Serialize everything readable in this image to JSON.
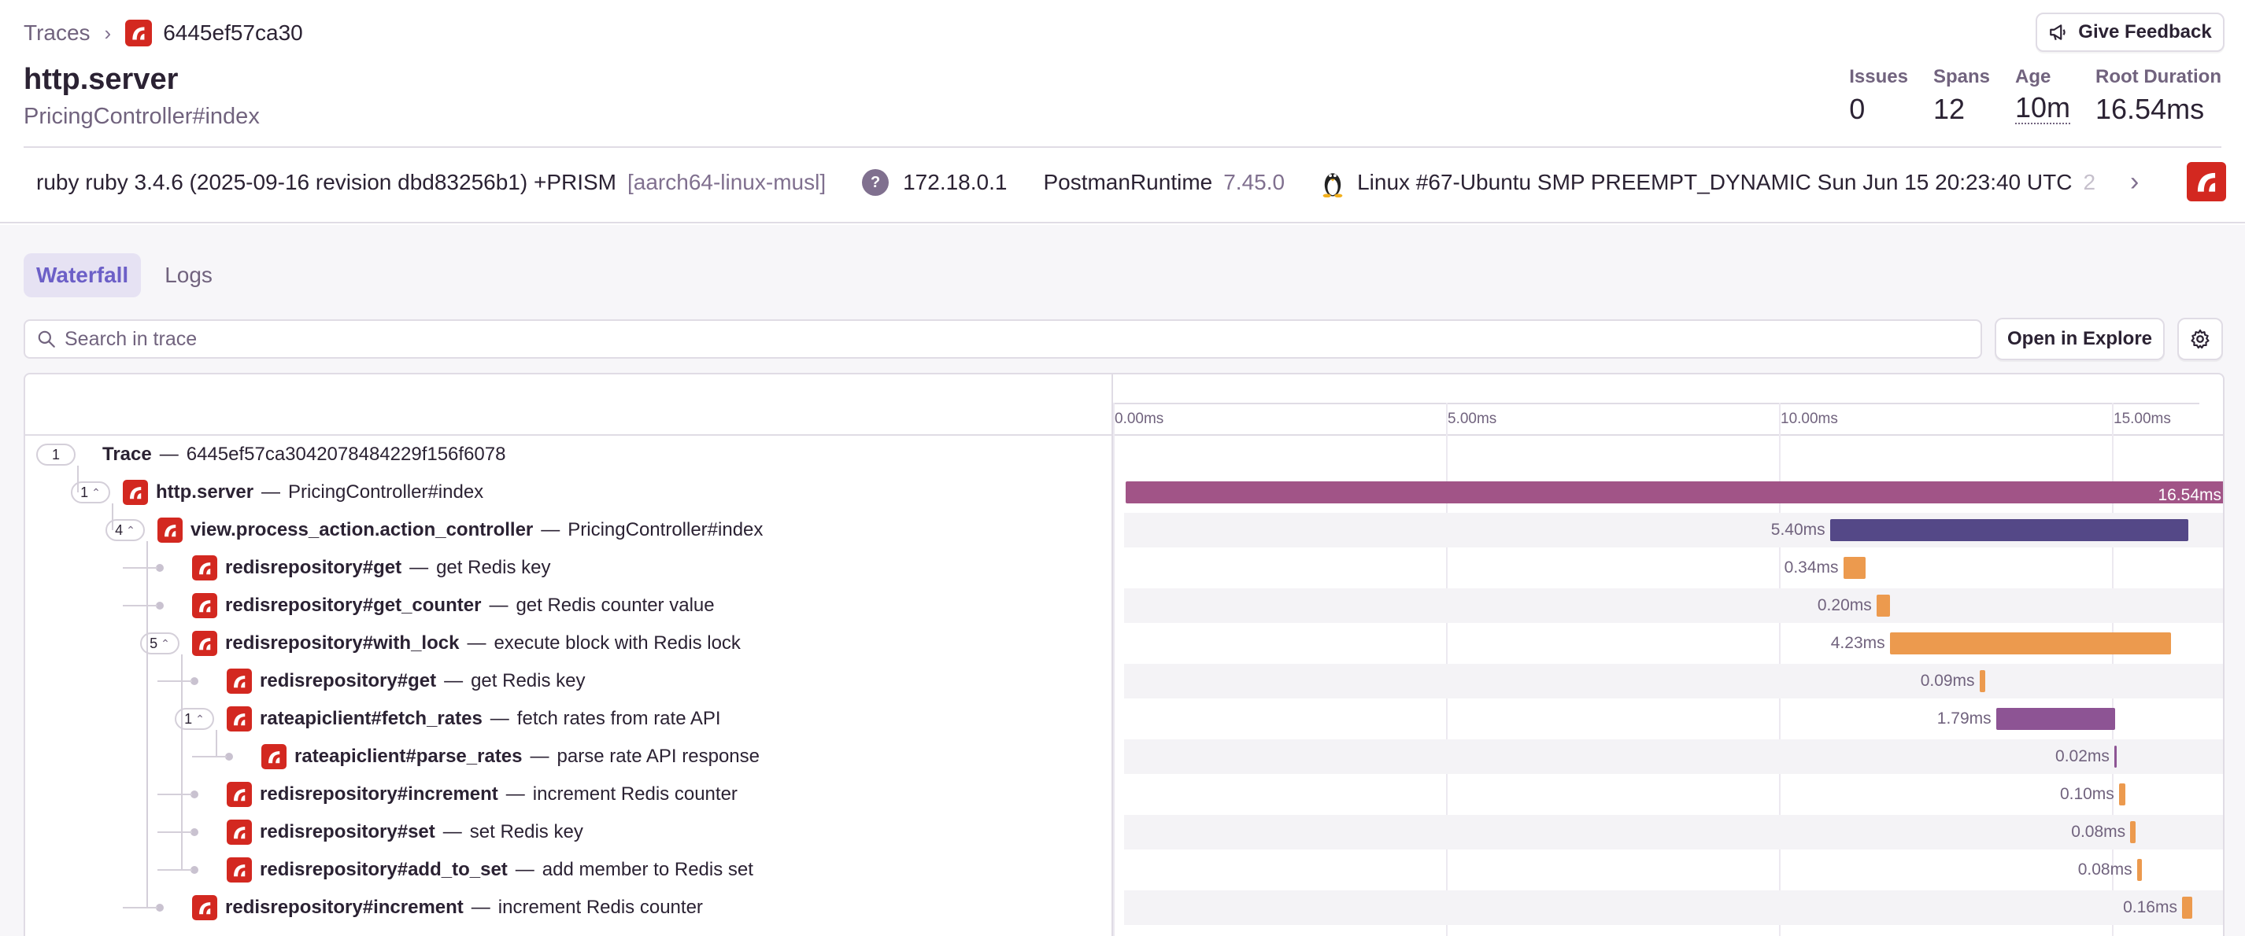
{
  "breadcrumb": {
    "root": "Traces",
    "separator": "›",
    "trace_id": "6445ef57ca30"
  },
  "feedback_button": "Give Feedback",
  "header": {
    "title": "http.server",
    "subtitle": "PricingController#index"
  },
  "stats": [
    {
      "label": "Issues",
      "value": "0"
    },
    {
      "label": "Spans",
      "value": "12"
    },
    {
      "label": "Age",
      "value": "10m"
    },
    {
      "label": "Root Duration",
      "value": "16.54ms"
    }
  ],
  "context": {
    "runtime": "ruby ruby 3.4.6 (2025-09-16 revision dbd83256b1) +PRISM",
    "runtime_arch": "[aarch64-linux-musl]",
    "ip_icon": "?",
    "ip": "172.18.0.1",
    "client": "PostmanRuntime",
    "client_version": "7.45.0",
    "os": "Linux #67-Ubuntu SMP PREEMPT_DYNAMIC Sun Jun 15 20:23:40 UTC",
    "os_overflow": "2"
  },
  "tabs": [
    {
      "label": "Waterfall",
      "active": true
    },
    {
      "label": "Logs",
      "active": false
    }
  ],
  "search": {
    "placeholder": "Search in trace",
    "value": ""
  },
  "explore_button": "Open in Explore",
  "timeline": {
    "ticks": [
      "0.00ms",
      "5.00ms",
      "10.00ms",
      "15.00ms"
    ]
  },
  "trace_row": {
    "count": "1",
    "label": "Trace",
    "trace_id": "6445ef57ca3042078484229f156f6078"
  },
  "spans": [
    {
      "op": "http.server",
      "desc": "PricingController#index",
      "depth": 0,
      "children": "1",
      "start": 0.0,
      "duration": 16.54,
      "duration_label": "16.54ms",
      "color": "#a15487"
    },
    {
      "op": "view.process_action.action_controller",
      "desc": "PricingController#index",
      "depth": 1,
      "children": "4",
      "start": 10.6,
      "duration": 5.4,
      "duration_label": "5.40ms",
      "color": "#544887"
    },
    {
      "op": "redisrepository#get",
      "desc": "get Redis key",
      "depth": 2,
      "children": "",
      "start": 10.8,
      "duration": 0.34,
      "duration_label": "0.34ms",
      "color": "#ec9a4e"
    },
    {
      "op": "redisrepository#get_counter",
      "desc": "get Redis counter value",
      "depth": 2,
      "children": "",
      "start": 11.3,
      "duration": 0.2,
      "duration_label": "0.20ms",
      "color": "#ec9a4e"
    },
    {
      "op": "redisrepository#with_lock",
      "desc": "execute block with Redis lock",
      "depth": 2,
      "children": "5",
      "start": 11.5,
      "duration": 4.23,
      "duration_label": "4.23ms",
      "color": "#ec9a4e"
    },
    {
      "op": "redisrepository#get",
      "desc": "get Redis key",
      "depth": 3,
      "children": "",
      "start": 12.85,
      "duration": 0.09,
      "duration_label": "0.09ms",
      "color": "#ec9a4e"
    },
    {
      "op": "rateapiclient#fetch_rates",
      "desc": "fetch rates from rate API",
      "depth": 3,
      "children": "1",
      "start": 13.1,
      "duration": 1.79,
      "duration_label": "1.79ms",
      "color": "#8d5494"
    },
    {
      "op": "rateapiclient#parse_rates",
      "desc": "parse rate API response",
      "depth": 4,
      "children": "",
      "start": 14.88,
      "duration": 0.02,
      "duration_label": "0.02ms",
      "color": "#8d5494"
    },
    {
      "op": "redisrepository#increment",
      "desc": "increment Redis counter",
      "depth": 3,
      "children": "",
      "start": 14.95,
      "duration": 0.1,
      "duration_label": "0.10ms",
      "color": "#ec9a4e"
    },
    {
      "op": "redisrepository#set",
      "desc": "set Redis key",
      "depth": 3,
      "children": "",
      "start": 15.12,
      "duration": 0.08,
      "duration_label": "0.08ms",
      "color": "#ec9a4e"
    },
    {
      "op": "redisrepository#add_to_set",
      "desc": "add member to Redis set",
      "depth": 3,
      "children": "",
      "start": 15.22,
      "duration": 0.08,
      "duration_label": "0.08ms",
      "color": "#ec9a4e"
    },
    {
      "op": "redisrepository#increment",
      "desc": "increment Redis counter",
      "depth": 2,
      "children": "",
      "start": 15.9,
      "duration": 0.16,
      "duration_label": "0.16ms",
      "color": "#ec9a4e"
    }
  ]
}
